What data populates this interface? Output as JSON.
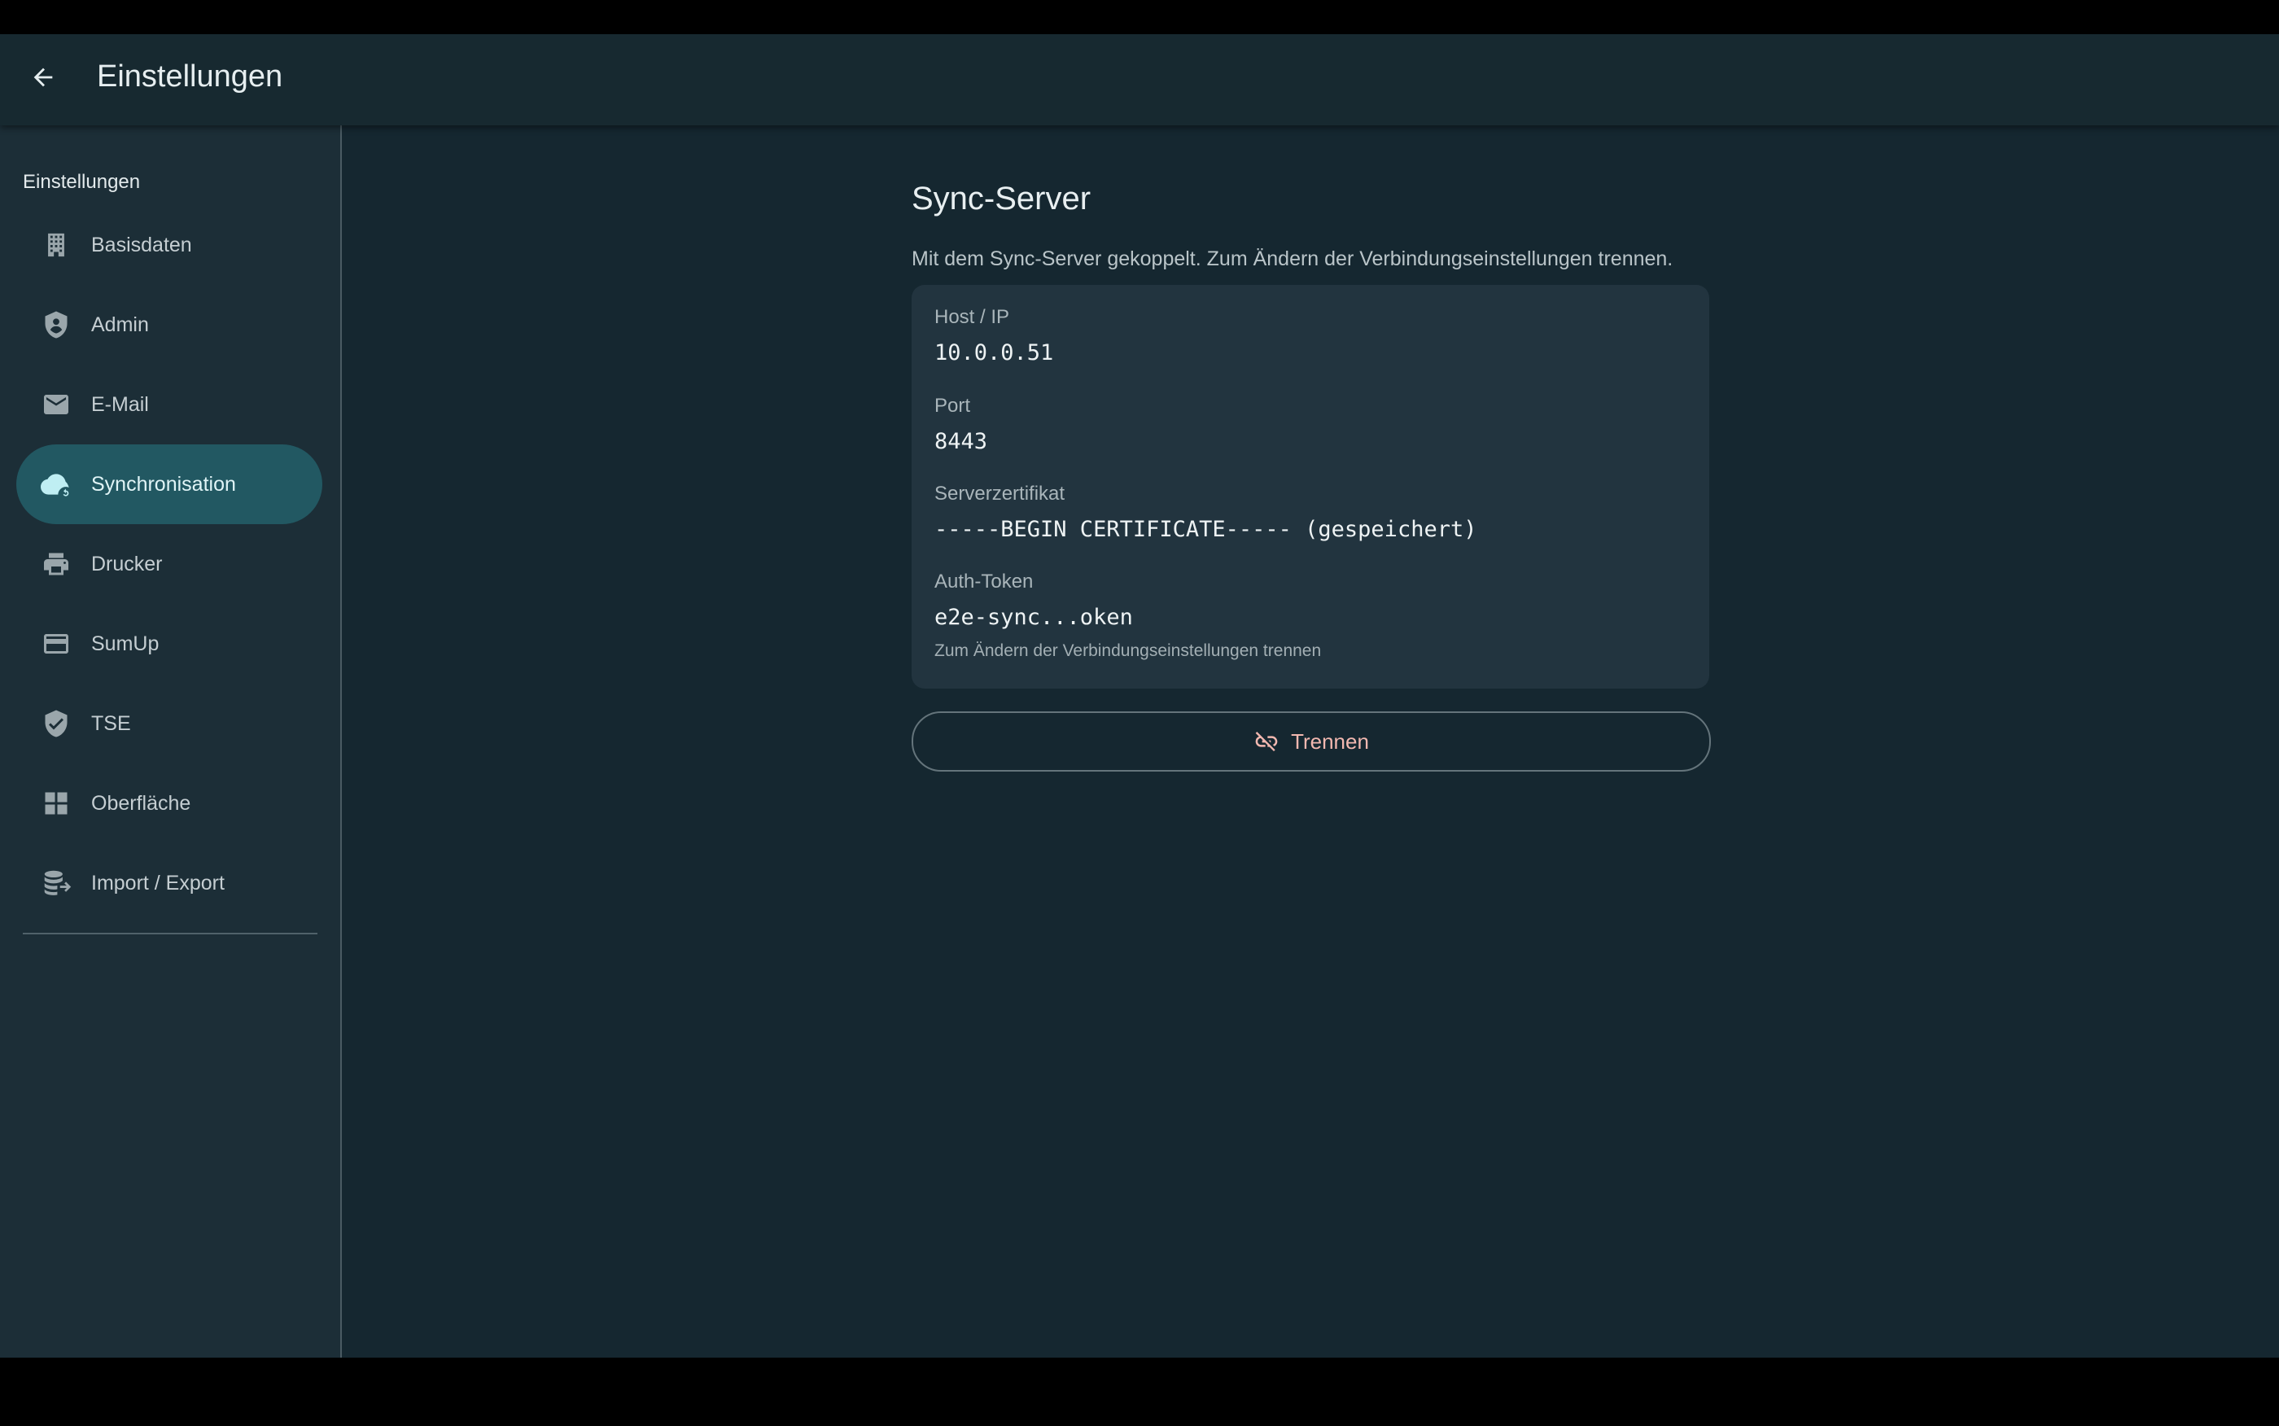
{
  "header": {
    "title": "Einstellungen",
    "back_icon": "arrow-back-icon"
  },
  "sidebar": {
    "heading": "Einstellungen",
    "items": [
      {
        "label": "Basisdaten",
        "icon": "building-icon"
      },
      {
        "label": "Admin",
        "icon": "admin-shield-icon"
      },
      {
        "label": "E-Mail",
        "icon": "mail-icon"
      },
      {
        "label": "Synchronisation",
        "icon": "cloud-sync-icon",
        "active": true
      },
      {
        "label": "Drucker",
        "icon": "printer-icon"
      },
      {
        "label": "SumUp",
        "icon": "card-icon"
      },
      {
        "label": "TSE",
        "icon": "verified-shield-icon"
      },
      {
        "label": "Oberfläche",
        "icon": "dashboard-icon"
      },
      {
        "label": "Import / Export",
        "icon": "database-export-icon"
      }
    ]
  },
  "main": {
    "title": "Sync-Server",
    "description": "Mit dem Sync-Server gekoppelt. Zum Ändern der Verbindungseinstellungen trennen.",
    "fields": [
      {
        "label": "Host / IP",
        "value": "10.0.0.51"
      },
      {
        "label": "Port",
        "value": "8443"
      },
      {
        "label": "Serverzertifikat",
        "value": "-----BEGIN CERTIFICATE----- (gespeichert)"
      },
      {
        "label": "Auth-Token",
        "value": "e2e-sync...oken",
        "hint": "Zum Ändern der Verbindungseinstellungen trennen"
      }
    ],
    "disconnect_label": "Trennen",
    "disconnect_icon": "link-off-icon"
  },
  "colors": {
    "background": "#152730",
    "sidebar": "#1c2e37",
    "active_item": "#225862",
    "card": "#22343f",
    "danger_text": "#f2b8b0"
  }
}
